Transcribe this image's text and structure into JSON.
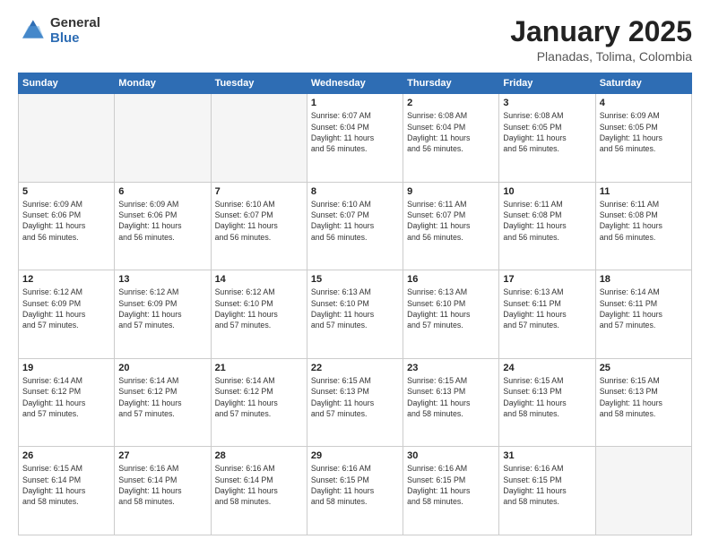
{
  "header": {
    "logo_general": "General",
    "logo_blue": "Blue",
    "title": "January 2025",
    "location": "Planadas, Tolima, Colombia"
  },
  "days_of_week": [
    "Sunday",
    "Monday",
    "Tuesday",
    "Wednesday",
    "Thursday",
    "Friday",
    "Saturday"
  ],
  "weeks": [
    [
      {
        "day": "",
        "info": ""
      },
      {
        "day": "",
        "info": ""
      },
      {
        "day": "",
        "info": ""
      },
      {
        "day": "1",
        "info": "Sunrise: 6:07 AM\nSunset: 6:04 PM\nDaylight: 11 hours\nand 56 minutes."
      },
      {
        "day": "2",
        "info": "Sunrise: 6:08 AM\nSunset: 6:04 PM\nDaylight: 11 hours\nand 56 minutes."
      },
      {
        "day": "3",
        "info": "Sunrise: 6:08 AM\nSunset: 6:05 PM\nDaylight: 11 hours\nand 56 minutes."
      },
      {
        "day": "4",
        "info": "Sunrise: 6:09 AM\nSunset: 6:05 PM\nDaylight: 11 hours\nand 56 minutes."
      }
    ],
    [
      {
        "day": "5",
        "info": "Sunrise: 6:09 AM\nSunset: 6:06 PM\nDaylight: 11 hours\nand 56 minutes."
      },
      {
        "day": "6",
        "info": "Sunrise: 6:09 AM\nSunset: 6:06 PM\nDaylight: 11 hours\nand 56 minutes."
      },
      {
        "day": "7",
        "info": "Sunrise: 6:10 AM\nSunset: 6:07 PM\nDaylight: 11 hours\nand 56 minutes."
      },
      {
        "day": "8",
        "info": "Sunrise: 6:10 AM\nSunset: 6:07 PM\nDaylight: 11 hours\nand 56 minutes."
      },
      {
        "day": "9",
        "info": "Sunrise: 6:11 AM\nSunset: 6:07 PM\nDaylight: 11 hours\nand 56 minutes."
      },
      {
        "day": "10",
        "info": "Sunrise: 6:11 AM\nSunset: 6:08 PM\nDaylight: 11 hours\nand 56 minutes."
      },
      {
        "day": "11",
        "info": "Sunrise: 6:11 AM\nSunset: 6:08 PM\nDaylight: 11 hours\nand 56 minutes."
      }
    ],
    [
      {
        "day": "12",
        "info": "Sunrise: 6:12 AM\nSunset: 6:09 PM\nDaylight: 11 hours\nand 57 minutes."
      },
      {
        "day": "13",
        "info": "Sunrise: 6:12 AM\nSunset: 6:09 PM\nDaylight: 11 hours\nand 57 minutes."
      },
      {
        "day": "14",
        "info": "Sunrise: 6:12 AM\nSunset: 6:10 PM\nDaylight: 11 hours\nand 57 minutes."
      },
      {
        "day": "15",
        "info": "Sunrise: 6:13 AM\nSunset: 6:10 PM\nDaylight: 11 hours\nand 57 minutes."
      },
      {
        "day": "16",
        "info": "Sunrise: 6:13 AM\nSunset: 6:10 PM\nDaylight: 11 hours\nand 57 minutes."
      },
      {
        "day": "17",
        "info": "Sunrise: 6:13 AM\nSunset: 6:11 PM\nDaylight: 11 hours\nand 57 minutes."
      },
      {
        "day": "18",
        "info": "Sunrise: 6:14 AM\nSunset: 6:11 PM\nDaylight: 11 hours\nand 57 minutes."
      }
    ],
    [
      {
        "day": "19",
        "info": "Sunrise: 6:14 AM\nSunset: 6:12 PM\nDaylight: 11 hours\nand 57 minutes."
      },
      {
        "day": "20",
        "info": "Sunrise: 6:14 AM\nSunset: 6:12 PM\nDaylight: 11 hours\nand 57 minutes."
      },
      {
        "day": "21",
        "info": "Sunrise: 6:14 AM\nSunset: 6:12 PM\nDaylight: 11 hours\nand 57 minutes."
      },
      {
        "day": "22",
        "info": "Sunrise: 6:15 AM\nSunset: 6:13 PM\nDaylight: 11 hours\nand 57 minutes."
      },
      {
        "day": "23",
        "info": "Sunrise: 6:15 AM\nSunset: 6:13 PM\nDaylight: 11 hours\nand 58 minutes."
      },
      {
        "day": "24",
        "info": "Sunrise: 6:15 AM\nSunset: 6:13 PM\nDaylight: 11 hours\nand 58 minutes."
      },
      {
        "day": "25",
        "info": "Sunrise: 6:15 AM\nSunset: 6:13 PM\nDaylight: 11 hours\nand 58 minutes."
      }
    ],
    [
      {
        "day": "26",
        "info": "Sunrise: 6:15 AM\nSunset: 6:14 PM\nDaylight: 11 hours\nand 58 minutes."
      },
      {
        "day": "27",
        "info": "Sunrise: 6:16 AM\nSunset: 6:14 PM\nDaylight: 11 hours\nand 58 minutes."
      },
      {
        "day": "28",
        "info": "Sunrise: 6:16 AM\nSunset: 6:14 PM\nDaylight: 11 hours\nand 58 minutes."
      },
      {
        "day": "29",
        "info": "Sunrise: 6:16 AM\nSunset: 6:15 PM\nDaylight: 11 hours\nand 58 minutes."
      },
      {
        "day": "30",
        "info": "Sunrise: 6:16 AM\nSunset: 6:15 PM\nDaylight: 11 hours\nand 58 minutes."
      },
      {
        "day": "31",
        "info": "Sunrise: 6:16 AM\nSunset: 6:15 PM\nDaylight: 11 hours\nand 58 minutes."
      },
      {
        "day": "",
        "info": ""
      }
    ]
  ]
}
